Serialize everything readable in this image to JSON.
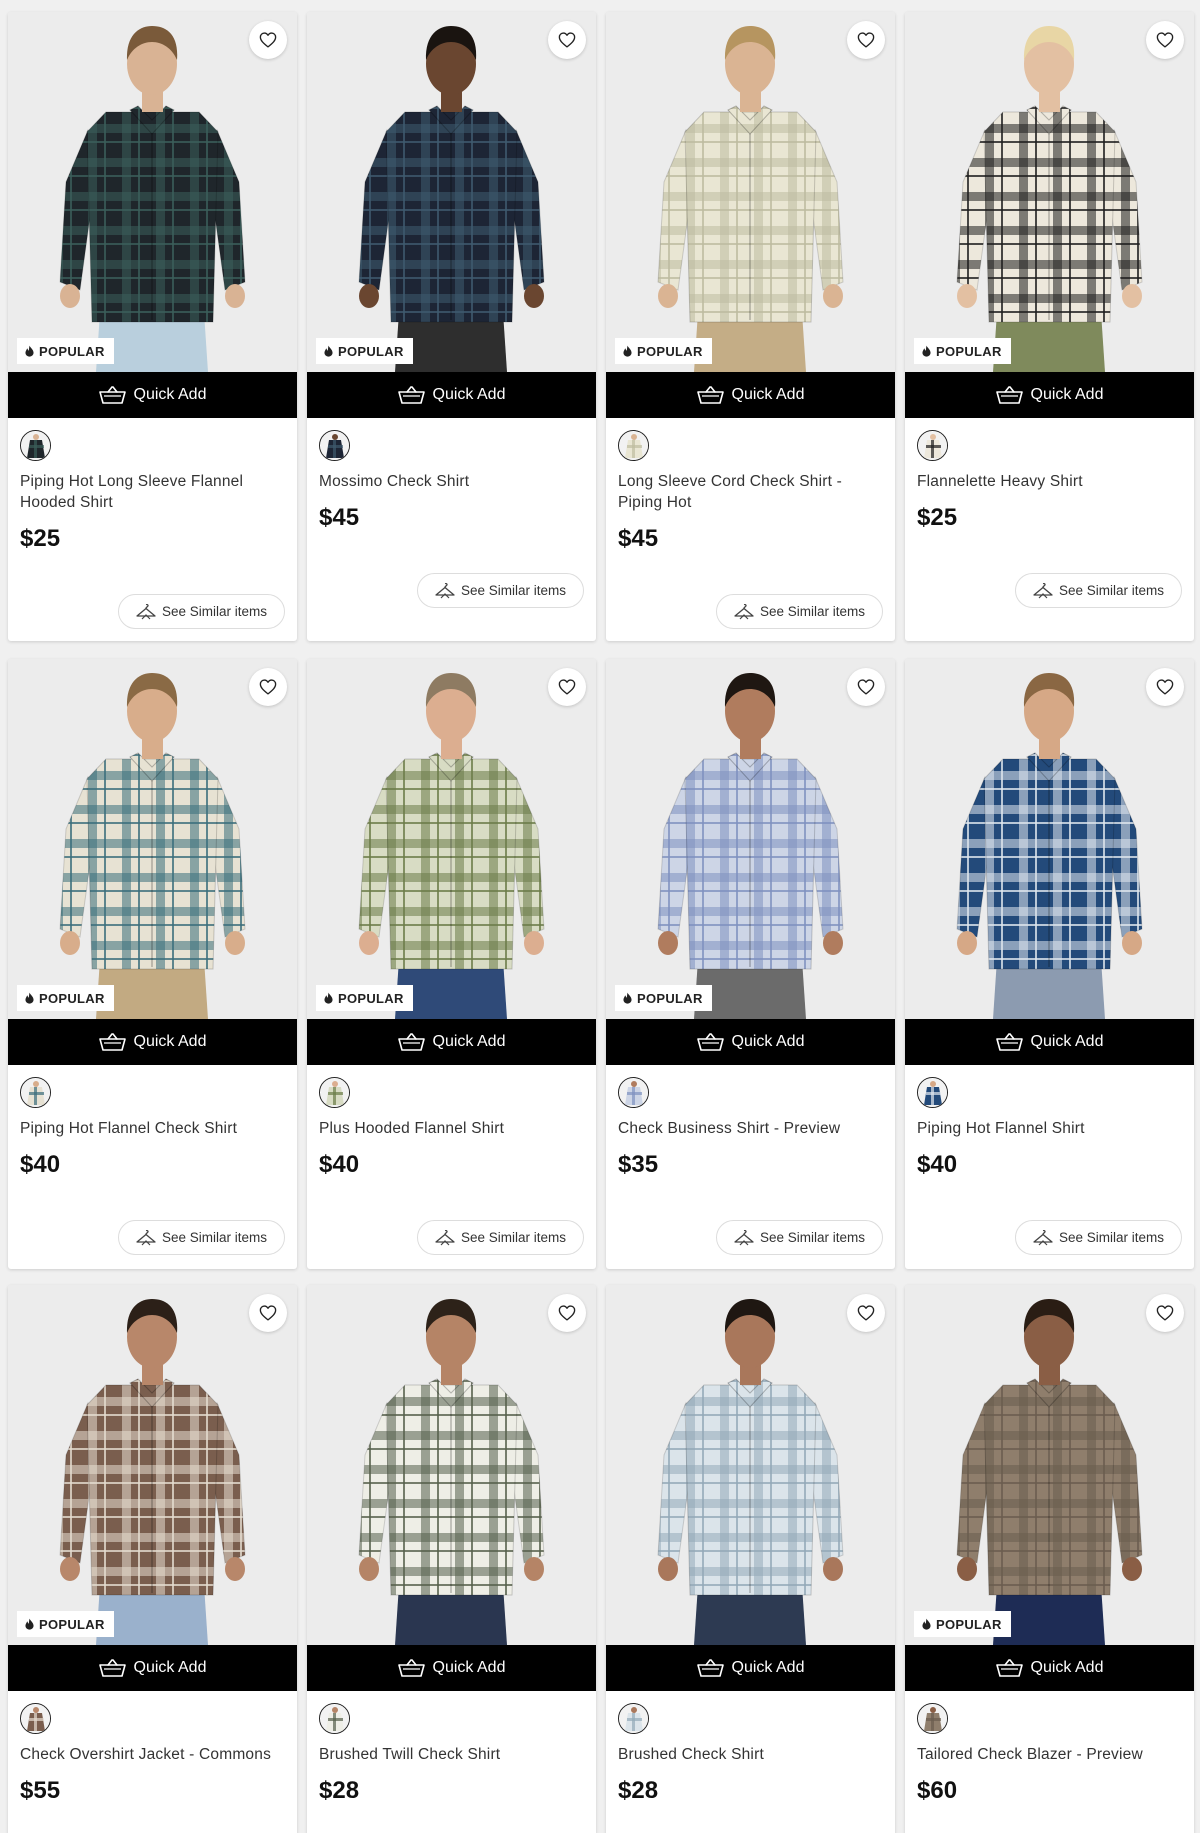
{
  "labels": {
    "popular": "POPULAR",
    "quick_add": "Quick Add",
    "see_similar": "See Similar items"
  },
  "products": [
    {
      "name": "Piping Hot Long Sleeve Flannel Hooded Shirt",
      "price": "$25",
      "popular": true,
      "colors": {
        "shirt": "#1f262b",
        "check": "#3b5e5a",
        "bg": "#ececec",
        "pants": "#b9cfdd",
        "skin": "#d9b394",
        "hair": "#7a5a3a"
      }
    },
    {
      "name": "Mossimo Check Shirt",
      "price": "$45",
      "popular": true,
      "colors": {
        "shirt": "#1d2535",
        "check": "#3e5a6e",
        "bg": "#ececec",
        "pants": "#2e2e2e",
        "skin": "#6a4630",
        "hair": "#1a1410"
      }
    },
    {
      "name": "Long Sleeve Cord Check Shirt - Piping Hot",
      "price": "$45",
      "popular": true,
      "colors": {
        "shirt": "#e9e6d3",
        "check": "#bdbca0",
        "bg": "#ececec",
        "pants": "#c4ad86",
        "skin": "#dab493",
        "hair": "#b69560"
      }
    },
    {
      "name": "Flannelette Heavy Shirt",
      "price": "$25",
      "popular": true,
      "colors": {
        "shirt": "#ede8dc",
        "check": "#1e1e1e",
        "bg": "#ececec",
        "pants": "#7f8a5c",
        "skin": "#e3c0a2",
        "hair": "#e8d6a5"
      }
    },
    {
      "name": "Piping Hot Flannel Check Shirt",
      "price": "$40",
      "popular": true,
      "colors": {
        "shirt": "#e7e2d3",
        "check": "#3b6e7c",
        "bg": "#ececec",
        "pants": "#c2aa82",
        "skin": "#d8ad8b",
        "hair": "#8a6a45"
      }
    },
    {
      "name": "Plus Hooded Flannel Shirt",
      "price": "$40",
      "popular": true,
      "colors": {
        "shirt": "#d8dcc4",
        "check": "#6b7c48",
        "bg": "#ececec",
        "pants": "#2f4a78",
        "skin": "#dcae90",
        "hair": "#8e7b62"
      }
    },
    {
      "name": "Check Business Shirt - Preview",
      "price": "$35",
      "popular": true,
      "colors": {
        "shirt": "#cdd5e6",
        "check": "#7f91bf",
        "bg": "#ececec",
        "pants": "#6b6b6b",
        "skin": "#b07c5e",
        "hair": "#1f1712"
      }
    },
    {
      "name": "Piping Hot Flannel Shirt",
      "price": "$40",
      "popular": false,
      "colors": {
        "shirt": "#234a7a",
        "check": "#dfe6ee",
        "bg": "#ececec",
        "pants": "#8c9bb0",
        "skin": "#d6a886",
        "hair": "#8a6743"
      }
    },
    {
      "name": "Check Overshirt Jacket - Commons",
      "price": "$55",
      "popular": true,
      "colors": {
        "shirt": "#7a5e4e",
        "check": "#e5dcd0",
        "bg": "#ececec",
        "pants": "#9ab1cc",
        "skin": "#b8876a",
        "hair": "#2c2018"
      }
    },
    {
      "name": "Brushed Twill Check Shirt",
      "price": "$28",
      "popular": false,
      "colors": {
        "shirt": "#eeeee6",
        "check": "#56604c",
        "bg": "#ececec",
        "pants": "#2a3650",
        "skin": "#b58466",
        "hair": "#2d2219"
      }
    },
    {
      "name": "Brushed Check Shirt",
      "price": "$28",
      "popular": false,
      "colors": {
        "shirt": "#dbe4ea",
        "check": "#93a9b8",
        "bg": "#ececec",
        "pants": "#2d3a52",
        "skin": "#a9775b",
        "hair": "#1f1712"
      }
    },
    {
      "name": "Tailored Check Blazer - Preview",
      "price": "$60",
      "popular": true,
      "colors": {
        "shirt": "#8f7e6c",
        "check": "#6a5c4f",
        "bg": "#ececec",
        "pants": "#1e2c55",
        "skin": "#8a5e45",
        "hair": "#2a1d14"
      }
    }
  ]
}
